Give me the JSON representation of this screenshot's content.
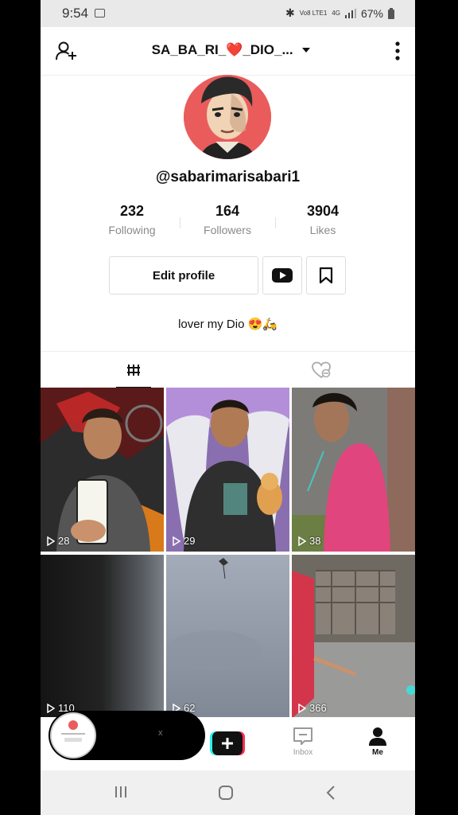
{
  "status_bar": {
    "time": "9:54",
    "network": "Vo8 LTE1",
    "signal": "4G",
    "battery": "67%"
  },
  "header": {
    "title": "SA_BA_RI_❤️_DIO_...",
    "icons": [
      "add-user-icon",
      "chevron-down-icon",
      "more-vertical-icon"
    ]
  },
  "profile": {
    "username": "@sabarimarisabari1",
    "stats": [
      {
        "value": "232",
        "label": "Following"
      },
      {
        "value": "164",
        "label": "Followers"
      },
      {
        "value": "3904",
        "label": "Likes"
      }
    ],
    "edit_label": "Edit profile",
    "bio": "lover  my Dio 😍🛵"
  },
  "tabs": [
    {
      "name": "videos",
      "icon": "grid-icon"
    },
    {
      "name": "liked",
      "icon": "liked-hidden-icon"
    }
  ],
  "videos": [
    {
      "views": "28"
    },
    {
      "views": "29"
    },
    {
      "views": "38"
    },
    {
      "views": "110"
    },
    {
      "views": "62"
    },
    {
      "views": "366"
    }
  ],
  "bottom_nav": {
    "pip_close": "x",
    "inbox_label": "Inbox",
    "me_label": "Me"
  },
  "colors": {
    "accent_red": "#fe2c55",
    "accent_cyan": "#25f4ee",
    "avatar_bg": "#ea5c5c"
  }
}
